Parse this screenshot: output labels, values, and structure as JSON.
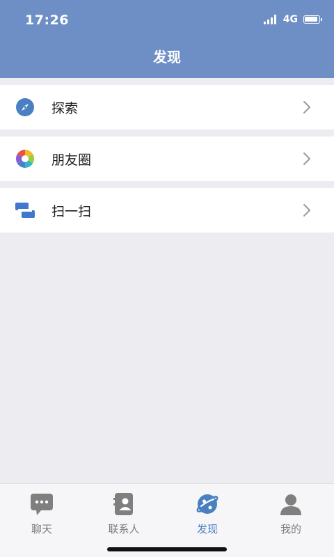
{
  "status_bar": {
    "time": "17:26",
    "network": "4G",
    "battery_level": 0.95
  },
  "header": {
    "title": "发现"
  },
  "menu": [
    {
      "label": "探索",
      "icon": "compass-icon"
    },
    {
      "label": "朋友圈",
      "icon": "aperture-icon"
    },
    {
      "label": "扫一扫",
      "icon": "scan-icon"
    }
  ],
  "tabs": [
    {
      "label": "聊天",
      "icon": "chat-icon",
      "active": false
    },
    {
      "label": "联系人",
      "icon": "contacts-icon",
      "active": false
    },
    {
      "label": "发现",
      "icon": "discover-planet-icon",
      "active": true
    },
    {
      "label": "我的",
      "icon": "person-icon",
      "active": false
    }
  ],
  "colors": {
    "header_bg": "#6e8fc6",
    "accent": "#4a7fc1",
    "page_bg": "#ececf1",
    "tab_inactive": "#7d7d7d"
  }
}
